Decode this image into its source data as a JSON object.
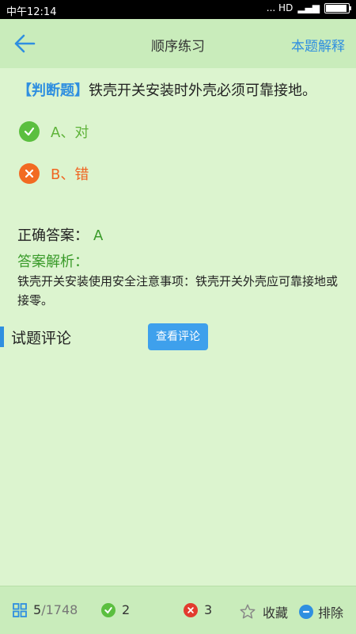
{
  "status": {
    "time": "中午12:14",
    "icons_text": "... HD"
  },
  "header": {
    "title": "顺序练习",
    "explain_label": "本题解释"
  },
  "question": {
    "type_label": "【判断题】",
    "text": "铁壳开关安装时外壳必须可靠接地。"
  },
  "options": [
    {
      "label": "A、对",
      "state": "correct"
    },
    {
      "label": "B、错",
      "state": "wrong"
    }
  ],
  "answer": {
    "label": "正确答案：",
    "value": "A"
  },
  "analysis": {
    "title": "答案解析：",
    "text": "铁壳开关安装使用安全注意事项：铁壳开关外壳应可靠接地或接零。"
  },
  "comments": {
    "label": "试题评论",
    "button_label": "查看评论"
  },
  "footer": {
    "progress_current": "5",
    "progress_total": "/1748",
    "correct_count": "2",
    "wrong_count": "3",
    "favorite_label": "收藏",
    "exclude_label": "排除"
  },
  "colors": {
    "accent": "#2f8fe0",
    "correct": "#5bbf3f",
    "wrong": "#f26a22",
    "background": "#dcf4cf"
  }
}
